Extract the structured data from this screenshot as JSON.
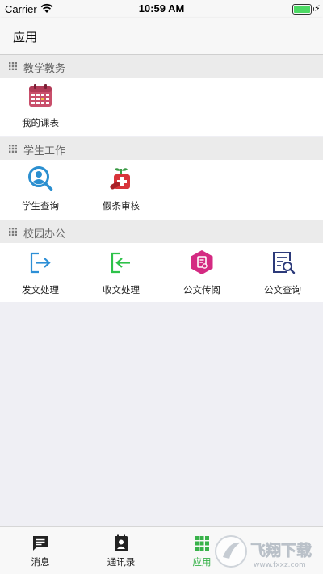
{
  "status_bar": {
    "carrier": "Carrier",
    "time": "10:59 AM"
  },
  "nav": {
    "title": "应用"
  },
  "sections": [
    {
      "title": "教学教务",
      "items": [
        {
          "label": "我的课表",
          "icon": "calendar-icon"
        }
      ]
    },
    {
      "title": "学生工作",
      "items": [
        {
          "label": "学生查询",
          "icon": "student-search-icon"
        },
        {
          "label": "假条审核",
          "icon": "leave-approval-icon"
        }
      ]
    },
    {
      "title": "校园办公",
      "items": [
        {
          "label": "发文处理",
          "icon": "send-document-icon"
        },
        {
          "label": "收文处理",
          "icon": "receive-document-icon"
        },
        {
          "label": "公文传阅",
          "icon": "circulate-document-icon"
        },
        {
          "label": "公文查询",
          "icon": "document-search-icon"
        }
      ]
    }
  ],
  "tabs": [
    {
      "label": "消息",
      "icon": "message-icon"
    },
    {
      "label": "通讯录",
      "icon": "contacts-icon"
    },
    {
      "label": "应用",
      "icon": "apps-grid-icon",
      "active": true
    }
  ],
  "watermark": {
    "text": "飞翔下载",
    "url": "www.fxxz.com"
  },
  "colors": {
    "accent_green": "#38b24a",
    "calendar": "#c94f6b",
    "student_blue": "#2b8fd0",
    "leave_red": "#d8343a",
    "send_blue": "#2d8fd6",
    "receive_green": "#2ec24a",
    "circulate_magenta": "#d42a82",
    "query_navy": "#2c3a7a"
  }
}
